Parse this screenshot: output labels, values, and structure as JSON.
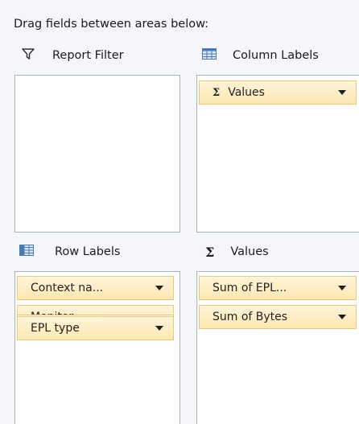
{
  "instruction": "Drag fields between areas below:",
  "areas": {
    "report_filter": {
      "label": "Report Filter",
      "icon": "filter-icon",
      "fields": []
    },
    "column_labels": {
      "label": "Column Labels",
      "icon": "table-grid-icon",
      "fields": [
        {
          "label": "Values",
          "icon": "sigma-icon"
        }
      ]
    },
    "row_labels": {
      "label": "Row Labels",
      "icon": "table-grid-icon",
      "fields": [
        {
          "label": "Context na..."
        },
        {
          "label": "Monitor"
        },
        {
          "label": "EPL type"
        }
      ]
    },
    "values": {
      "label": "Values",
      "icon": "sigma-icon",
      "fields": [
        {
          "label": "Sum of  EPL..."
        },
        {
          "label": "Sum of  Bytes"
        }
      ]
    }
  },
  "colors": {
    "field_fill": "#fde7b2",
    "field_border": "#e8c97d",
    "box_border": "#a9b3bf",
    "grid_icon": "#4b79b6"
  }
}
